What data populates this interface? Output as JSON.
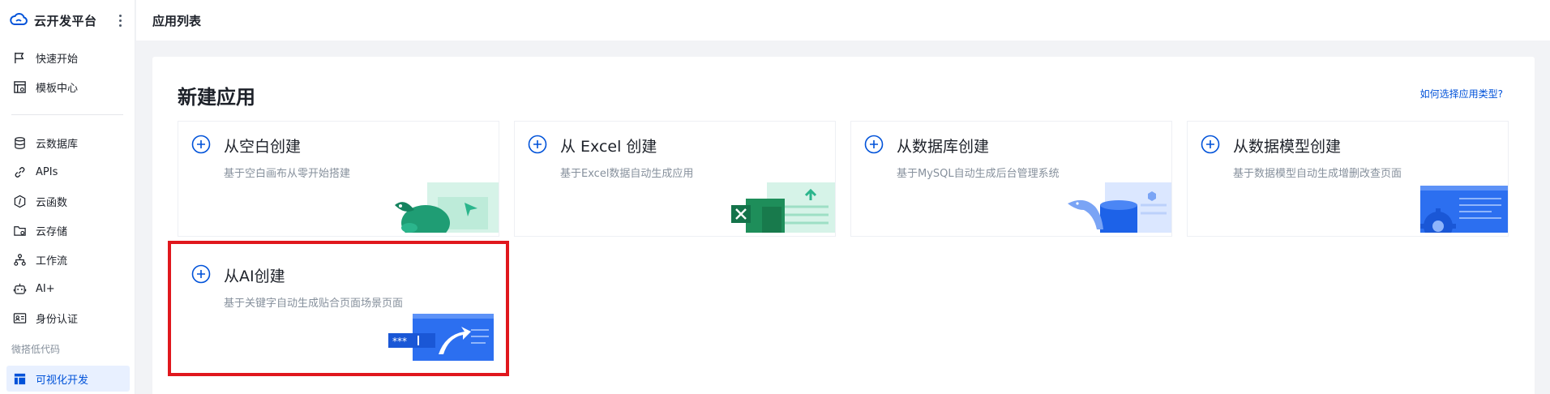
{
  "sidebar": {
    "brand_title": "云开发平台",
    "items": [
      {
        "label": "快速开始",
        "icon": "flag-icon"
      },
      {
        "label": "模板中心",
        "icon": "template-icon"
      },
      {
        "label": "云数据库",
        "icon": "database-icon"
      },
      {
        "label": "APIs",
        "icon": "link-icon"
      },
      {
        "label": "云函数",
        "icon": "function-icon"
      },
      {
        "label": "云存储",
        "icon": "folder-icon"
      },
      {
        "label": "工作流",
        "icon": "workflow-icon"
      },
      {
        "label": "AI+",
        "icon": "robot-icon"
      },
      {
        "label": "身份认证",
        "icon": "id-card-icon"
      }
    ],
    "group_label": "微搭低代码",
    "active_item": {
      "label": "可视化开发",
      "icon": "layout-icon"
    }
  },
  "header": {
    "title": "应用列表"
  },
  "main": {
    "heading": "新建应用",
    "help_link": "如何选择应用类型?",
    "cards": [
      {
        "title": "从空白创建",
        "desc": "基于空白画布从零开始搭建"
      },
      {
        "title": "从 Excel 创建",
        "desc": "基于Excel数据自动生成应用"
      },
      {
        "title": "从数据库创建",
        "desc": "基于MySQL自动生成后台管理系统"
      },
      {
        "title": "从数据模型创建",
        "desc": "基于数据模型自动生成增删改查页面"
      },
      {
        "title": "从AI创建",
        "desc": "基于关键字自动生成贴合页面场景页面"
      }
    ]
  },
  "colors": {
    "accent": "#0052d9",
    "highlight": "#e0171d",
    "teal": "#2bb58c",
    "excel_green": "#1e8e5a"
  }
}
